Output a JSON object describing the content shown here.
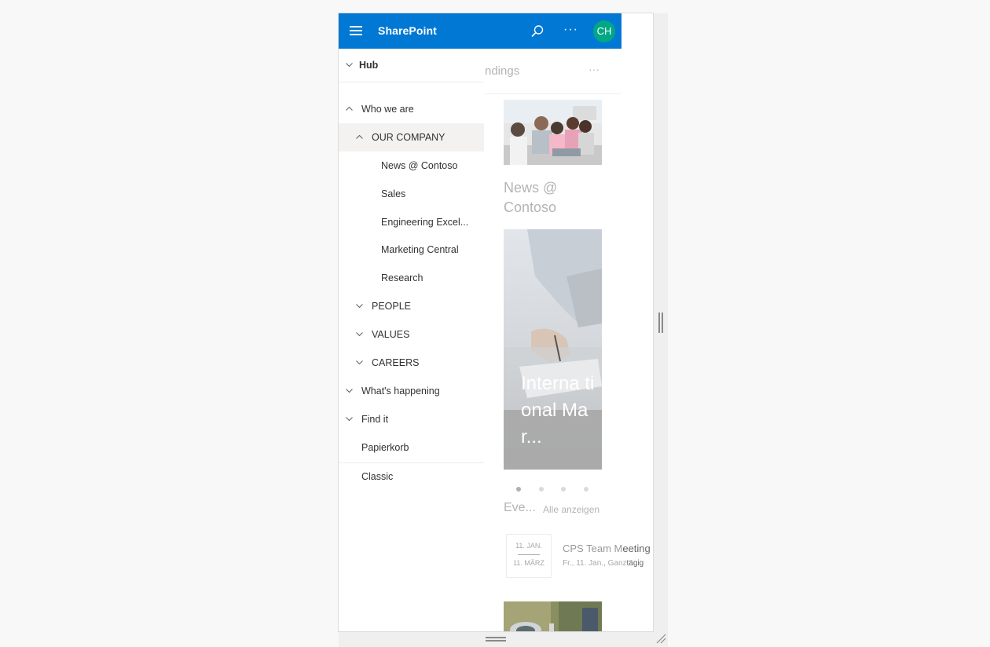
{
  "header": {
    "app_title": "SharePoint",
    "more_label": "···",
    "avatar_initials": "CH",
    "accent_color": "#0078d4",
    "avatar_color": "#00a884"
  },
  "page": {
    "section_heading": "ndings",
    "more_label": "···",
    "news_title": "News @ Contoso",
    "hero_text": "International Mar...",
    "hero_text_shown": "Interna tional Mar...",
    "carousel": {
      "count": 4,
      "active": 1
    },
    "events_label": "Eve...",
    "events_show_all": "Alle anzeigen",
    "event": {
      "date_start": "11. JAN.",
      "date_end": "11. MÄRZ",
      "title_light": "CPS Team M",
      "title_dark": "eeting",
      "sub_light": "Fr., 11. Jan., Ganz",
      "sub_dark": "tägig"
    }
  },
  "nav": {
    "hub": "Hub",
    "who_we_are": "Who we are",
    "our_company": "OUR COMPANY",
    "news": "News @ Contoso",
    "sales": "Sales",
    "engineering": "Engineering Excel...",
    "marketing": "Marketing Central",
    "research": "Research",
    "people": "PEOPLE",
    "values": "VALUES",
    "careers": "CAREERS",
    "whats_happening": "What's happening",
    "find_it": "Find it",
    "papierkorb": "Papierkorb",
    "classic": "Classic"
  },
  "icons": [
    "hamburger-icon",
    "search-icon",
    "more-icon",
    "chevron-down-icon",
    "chevron-up-icon",
    "resize-grip-icon"
  ]
}
